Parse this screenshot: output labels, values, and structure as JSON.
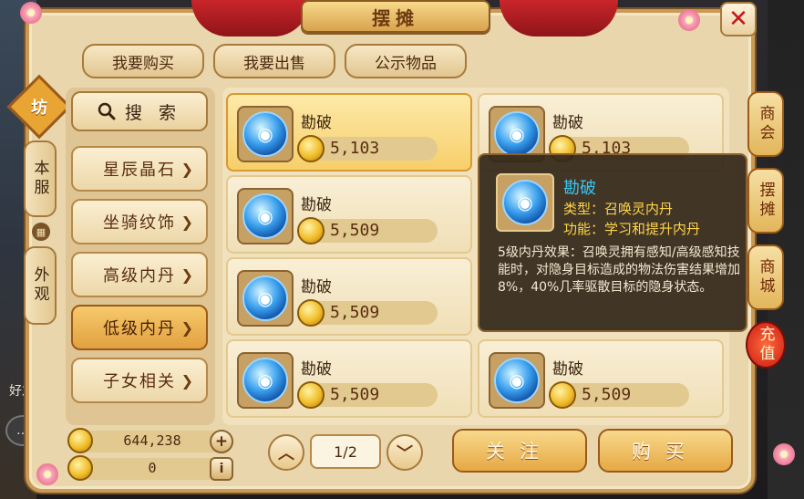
{
  "window": {
    "title": "摆摊",
    "close_glyph": "✕"
  },
  "top_tabs": [
    {
      "label": "我要购买"
    },
    {
      "label": "我要出售"
    },
    {
      "label": "公示物品"
    }
  ],
  "side_badge": "坊",
  "side_tabs": [
    {
      "label": "本服"
    },
    {
      "label": "外观"
    }
  ],
  "search": {
    "label": "搜 索",
    "icon": "search-icon"
  },
  "categories": [
    {
      "label": "星辰晶石"
    },
    {
      "label": "坐骑纹饰"
    },
    {
      "label": "高级内丹"
    },
    {
      "label": "低级内丹",
      "active": true
    },
    {
      "label": "子女相关"
    }
  ],
  "items": [
    {
      "name": "勘破",
      "price": "5,103",
      "selected": true
    },
    {
      "name": "勘破",
      "price": "5,103"
    },
    {
      "name": "勘破",
      "price": "5,509"
    },
    {
      "name": "勘破",
      "price": "5,509"
    },
    {
      "name": "勘破",
      "price": "5,509"
    },
    {
      "name": "勘破",
      "price": "5,509"
    }
  ],
  "tooltip": {
    "name": "勘破",
    "type_line": "类型：召唤灵内丹",
    "func_line": "功能：学习和提升内丹",
    "description": "5级内丹效果：召唤灵拥有感知/高级感知技能时，对隐身目标造成的物法伤害结果增加8%，40%几率驱散目标的隐身状态。"
  },
  "currency": [
    {
      "value": "644,238",
      "action": "+"
    },
    {
      "value": "0",
      "action": "i"
    }
  ],
  "pagination": {
    "current": "1/2",
    "up_glyph": "︿",
    "down_glyph": "﹀"
  },
  "actions": {
    "follow": "关注",
    "buy": "购买"
  },
  "right_tabs": [
    {
      "label": "商会"
    },
    {
      "label": "摆摊"
    },
    {
      "label": "商城"
    },
    {
      "label": "充值"
    }
  ],
  "hud": {
    "friend": "好友",
    "chat_glyph": "…"
  },
  "colors": {
    "accent_gold": "#e6a844",
    "tooltip_name": "#38c6f5",
    "tooltip_meta": "#ffd54a",
    "recharge_red": "#c91a14"
  }
}
